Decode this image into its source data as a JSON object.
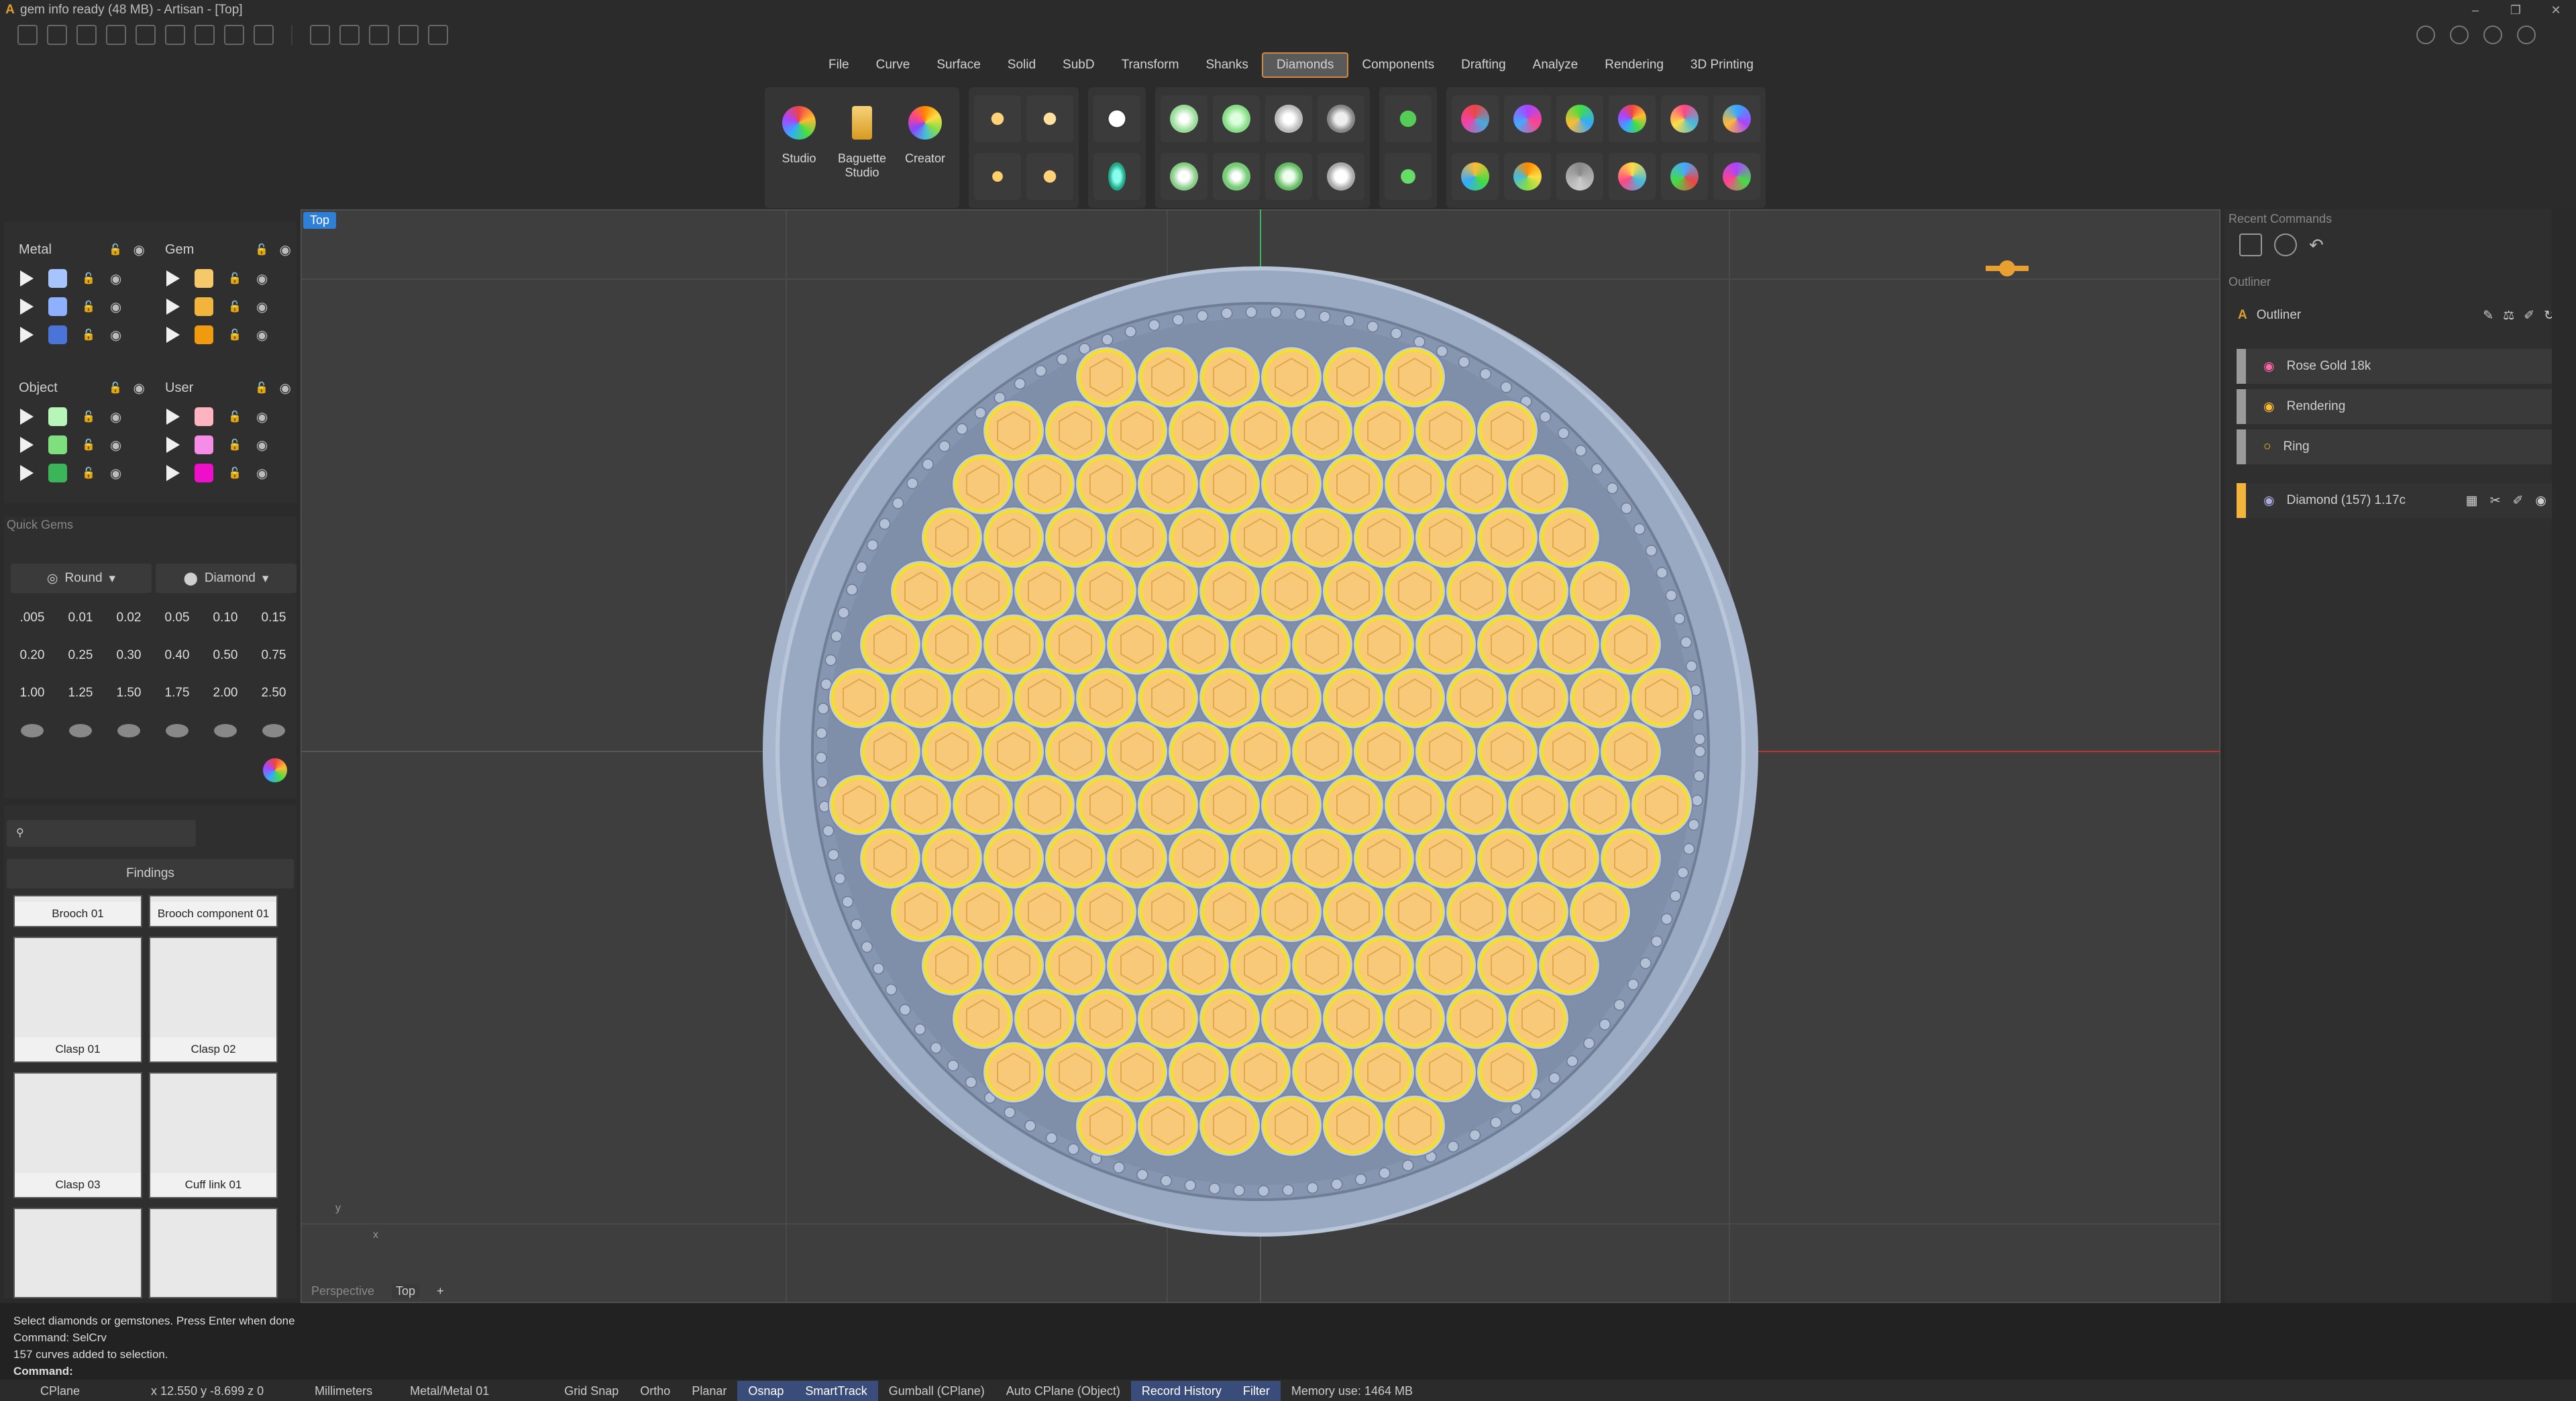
{
  "window": {
    "title": "gem info ready (48 MB) - Artisan - [Top]",
    "controls": [
      "–",
      "❐",
      "✕"
    ]
  },
  "menu": {
    "tabs": [
      "File",
      "Curve",
      "Surface",
      "Solid",
      "SubD",
      "Transform",
      "Shanks",
      "Diamonds",
      "Components",
      "Drafting",
      "Analyze",
      "Rendering",
      "3D Printing"
    ],
    "active": "Diamonds"
  },
  "ribbon": {
    "studio": "Studio",
    "baguette": "Baguette Studio",
    "creator": "Creator"
  },
  "layers": {
    "metal": {
      "label": "Metal",
      "colors": [
        "#a8c4ff",
        "#8fb0ff",
        "#4a74d8"
      ]
    },
    "gem": {
      "label": "Gem",
      "colors": [
        "#f5c86a",
        "#f2b43c",
        "#f09a10"
      ]
    },
    "object": {
      "label": "Object",
      "colors": [
        "#b8f5b8",
        "#7fdf7f",
        "#3cb45a"
      ]
    },
    "user": {
      "label": "User",
      "colors": [
        "#ffb3c0",
        "#f58ce8",
        "#ee10c8"
      ]
    }
  },
  "quick_gems": {
    "title": "Quick Gems",
    "shape": "Round",
    "material": "Diamond",
    "sizes": [
      ".005",
      "0.01",
      "0.02",
      "0.05",
      "0.10",
      "0.15",
      "0.20",
      "0.25",
      "0.30",
      "0.40",
      "0.50",
      "0.75",
      "1.00",
      "1.25",
      "1.50",
      "1.75",
      "2.00",
      "2.50"
    ]
  },
  "library": {
    "category": "Findings",
    "items": [
      "Brooch 01",
      "Brooch component 01",
      "Clasp 01",
      "Clasp 02",
      "Clasp 03",
      "Cuff link 01"
    ]
  },
  "viewport": {
    "label": "Top",
    "tabs": [
      "Perspective",
      "Top",
      "+"
    ],
    "axis_x": "x",
    "axis_y": "y"
  },
  "recent_commands": {
    "title": "Recent Commands"
  },
  "outliner": {
    "title": "Outliner",
    "header": "Outliner",
    "items": [
      "Rose Gold 18k",
      "Rendering",
      "Ring"
    ],
    "selection": "Diamond (157) 1.17c"
  },
  "command": {
    "lines": [
      "Select diamonds or gemstones. Press Enter when done",
      "Command: SelCrv",
      "157 curves added to selection."
    ],
    "prompt": "Command:"
  },
  "status": {
    "cplane": "CPlane",
    "coords": "x 12.550  y -8.699  z 0",
    "units": "Millimeters",
    "layer": "Metal/Metal 01",
    "grid_snap": "Grid Snap",
    "ortho": "Ortho",
    "planar": "Planar",
    "osnap": "Osnap",
    "smarttrack": "SmartTrack",
    "gumball": "Gumball (CPlane)",
    "auto_cplane": "Auto CPlane (Object)",
    "record_history": "Record History",
    "filter": "Filter",
    "memory": "Memory use: 1464 MB"
  }
}
